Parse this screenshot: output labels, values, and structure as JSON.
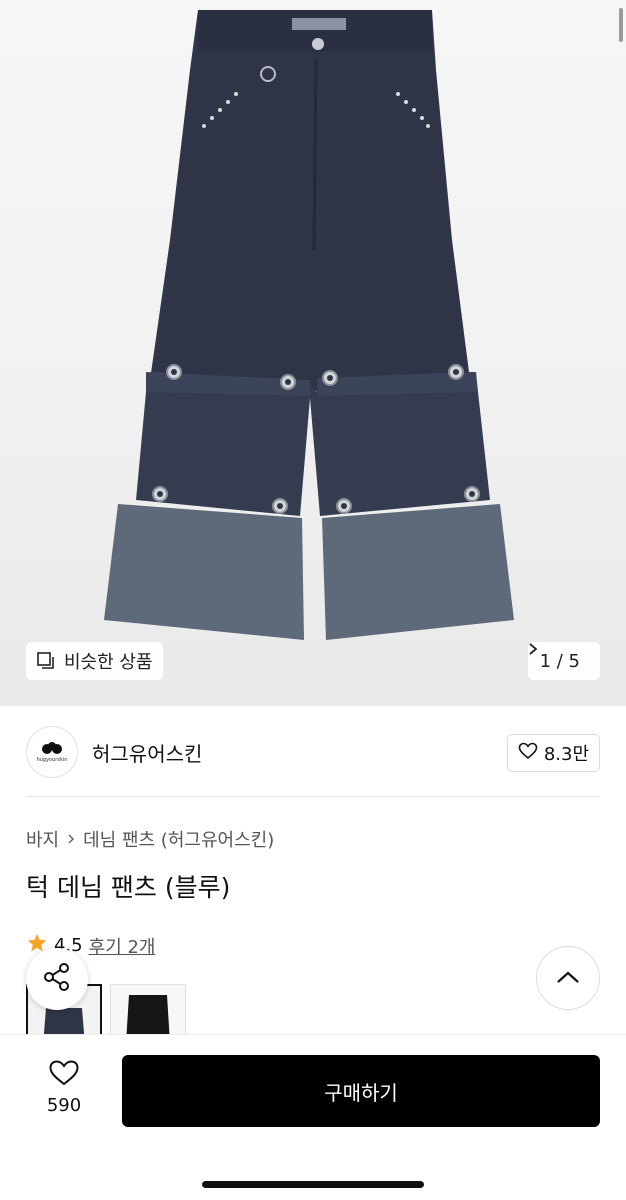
{
  "hero": {
    "similar_label": "비슷한 상품",
    "counter": "1 / 5",
    "label_tag": "HUGYOURSKIN"
  },
  "brand": {
    "name": "허그유어스킨",
    "logo_text": "hugyourskin",
    "likes": "8.3만"
  },
  "breadcrumb": {
    "category": "바지",
    "subcategory": "데님 팬츠 (허그유어스킨)"
  },
  "product": {
    "title": "턱 데님 팬츠 (블루)"
  },
  "rating": {
    "score": "4.5",
    "reviews": "후기 2개"
  },
  "bottom": {
    "wish_count": "590",
    "buy_label": "구매하기"
  },
  "icons": {
    "similar": "copy-icon",
    "next": "chevron-right-icon",
    "like": "heart-icon",
    "star": "star-icon",
    "share": "share-icon",
    "top": "chevron-up-icon"
  },
  "colors": {
    "accent_star": "#F5A623",
    "buy_button": "#000000",
    "denim_dark": "#2E3445",
    "denim_light": "#5E6A79"
  }
}
